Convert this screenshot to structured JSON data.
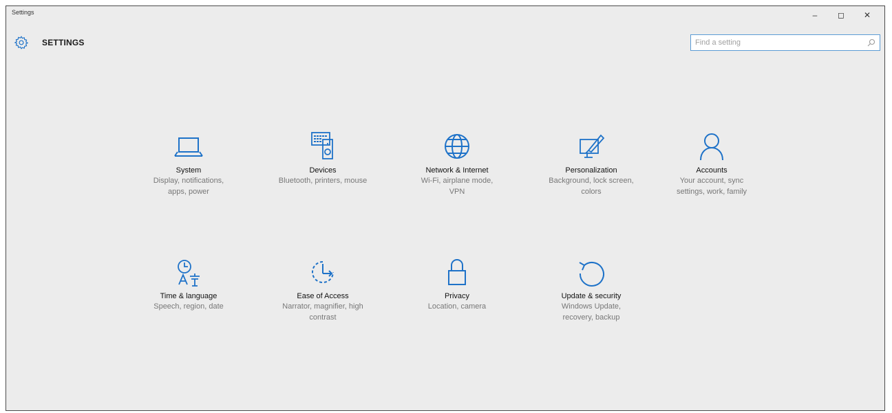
{
  "window": {
    "title": "Settings",
    "controls": {
      "minimize": "–",
      "maximize": "◻",
      "close": "✕"
    }
  },
  "header": {
    "title": "SETTINGS",
    "icon": "gear-icon"
  },
  "search": {
    "placeholder": "Find a setting",
    "value": "",
    "icon": "search-icon"
  },
  "accent_color": "#1e72c8",
  "categories": [
    {
      "label": "System",
      "description": "Display, notifications, apps, power",
      "icon": "laptop-icon"
    },
    {
      "label": "Devices",
      "description": "Bluetooth, printers, mouse",
      "icon": "devices-icon"
    },
    {
      "label": "Network & Internet",
      "description": "Wi-Fi, airplane mode, VPN",
      "icon": "globe-icon"
    },
    {
      "label": "Personalization",
      "description": "Background, lock screen, colors",
      "icon": "paint-icon"
    },
    {
      "label": "Accounts",
      "description": "Your account, sync settings, work, family",
      "icon": "person-icon"
    },
    {
      "label": "Time & language",
      "description": "Speech, region, date",
      "icon": "time-language-icon"
    },
    {
      "label": "Ease of Access",
      "description": "Narrator, magnifier, high contrast",
      "icon": "ease-of-access-icon"
    },
    {
      "label": "Privacy",
      "description": "Location, camera",
      "icon": "lock-icon"
    },
    {
      "label": "Update & security",
      "description": "Windows Update, recovery, backup",
      "icon": "update-icon"
    }
  ]
}
